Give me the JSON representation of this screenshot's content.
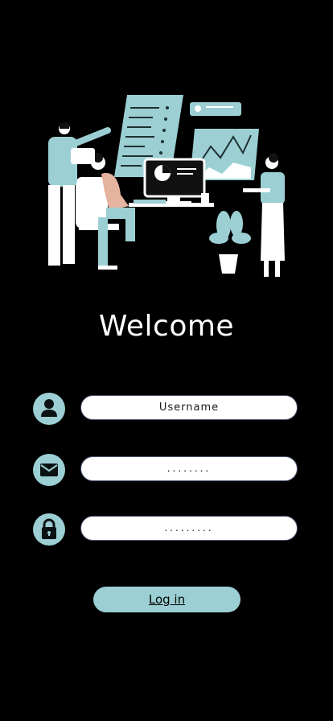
{
  "colors": {
    "background": "#000000",
    "accent": "#9ccfd3",
    "field_border": "#47506c"
  },
  "hero": {
    "illustration": "team-at-computer-illustration"
  },
  "welcome": {
    "title": "Welcome"
  },
  "form": {
    "username": {
      "icon": "user-icon",
      "value": "Username"
    },
    "email": {
      "icon": "mail-icon",
      "value": "........"
    },
    "password": {
      "icon": "lock-icon",
      "value": "........."
    }
  },
  "login_button": {
    "label": "Log in"
  }
}
